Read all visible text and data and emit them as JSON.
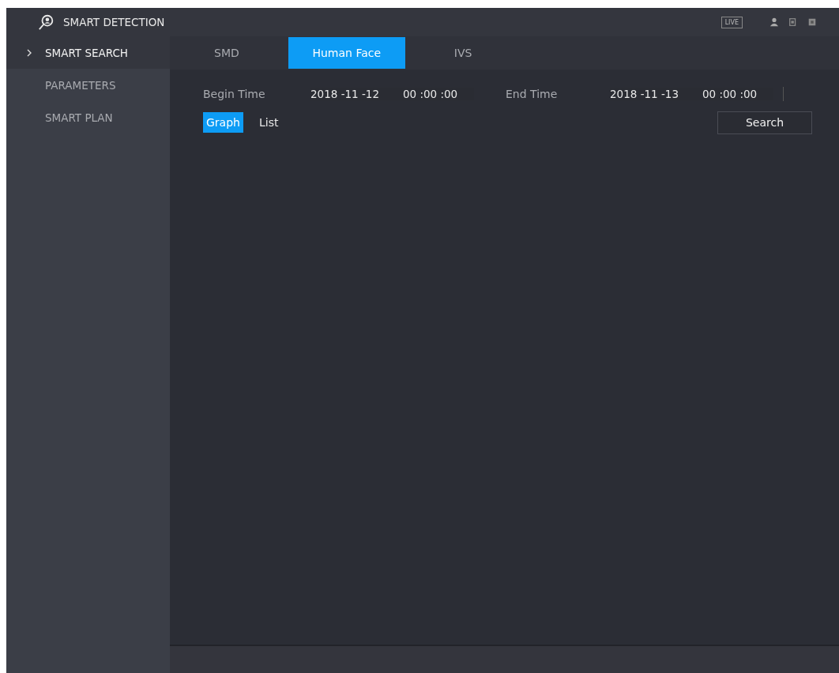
{
  "header": {
    "title": "SMART DETECTION",
    "live_button": "LIVE"
  },
  "sidebar": {
    "items": [
      {
        "label": "SMART SEARCH",
        "selected": true
      },
      {
        "label": "PARAMETERS",
        "selected": false
      },
      {
        "label": "SMART PLAN",
        "selected": false
      }
    ]
  },
  "tabs": [
    {
      "label": "SMD",
      "selected": false
    },
    {
      "label": "Human Face",
      "selected": true
    },
    {
      "label": "IVS",
      "selected": false
    }
  ],
  "search_form": {
    "begin_time": {
      "label": "Begin Time",
      "date": "2018 -11 -12",
      "time": "00 :00 :00"
    },
    "end_time": {
      "label": "End Time",
      "date": "2018 -11 -13",
      "time": "00 :00 :00"
    },
    "view_modes": [
      {
        "label": "Graph",
        "selected": true
      },
      {
        "label": "List",
        "selected": false
      }
    ],
    "search_button": "Search"
  }
}
